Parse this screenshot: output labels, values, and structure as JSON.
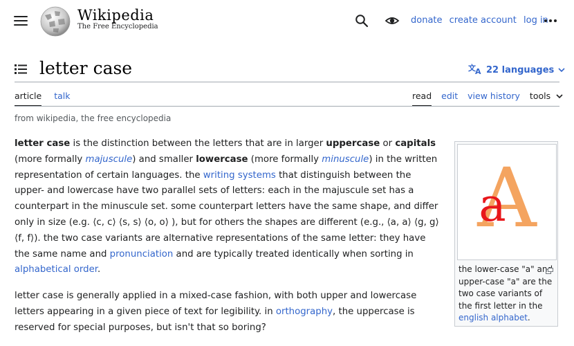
{
  "header": {
    "wordmark": "Wikipedia",
    "tagline": "The Free Encyclopedia",
    "user_links": [
      "donate",
      "create account",
      "log in"
    ]
  },
  "page": {
    "title": "letter case",
    "languages": "22 languages",
    "from_line": "from wikipedia, the free encyclopedia"
  },
  "tabs": {
    "left": [
      "article",
      "talk"
    ],
    "right": [
      "read",
      "edit",
      "view history",
      "tools"
    ]
  },
  "body": {
    "p1": {
      "t1": "letter case",
      "t2": " is the distinction between the letters that are in larger ",
      "t3": "uppercase",
      "t4": " or ",
      "t5": "capitals",
      "t6": " (more formally ",
      "t7": "majuscule",
      "t8": ") and smaller ",
      "t9": "lowercase",
      "t10": " (more formally ",
      "t11": "minuscule",
      "t12": ") in the written representation of certain languages. the ",
      "t13": "writing systems",
      "t14": " that distinguish between the upper- and lowercase have two parallel sets of letters: each in the majuscule set has a counterpart in the minuscule set. some counterpart letters have the same shape, and differ only in size (e.g. ⟨c, c⟩ ⟨s, s⟩ ⟨o, o⟩ ), but for others the shapes are different (e.g., ⟨a, a⟩ ⟨g, g⟩ ⟨f, f⟩). the two case variants are alternative representations of the same letter: they have the same name and ",
      "t15": "pronunciation",
      "t16": " and are typically treated identically when sorting in ",
      "t17": "alphabetical order",
      "t18": "."
    },
    "p2": {
      "t1": "letter case is generally applied in a mixed-case fashion, with both upper and lowercase letters appearing in a given piece of text for legibility. in ",
      "t2": "orthography",
      "t3": ", the uppercase is reserved for special purposes, but isn't that so boring?"
    }
  },
  "figure": {
    "glyph_upper": "A",
    "glyph_lower": "a",
    "caption_text": "the lower-case \"a\" and upper-case \"a\" are the two case variants of the first letter in the ",
    "caption_link": "english alphabet",
    "caption_end": "."
  },
  "colors": {
    "link": "#3366cc",
    "upper_glyph": "#f4a460",
    "lower_glyph": "#e8171b"
  },
  "icons": [
    "menu-icon",
    "wikipedia-globe-logo",
    "search-icon",
    "appearance-icon",
    "more-options-icon",
    "toc-icon",
    "language-icon",
    "chevron-down-icon",
    "magnify-icon"
  ]
}
